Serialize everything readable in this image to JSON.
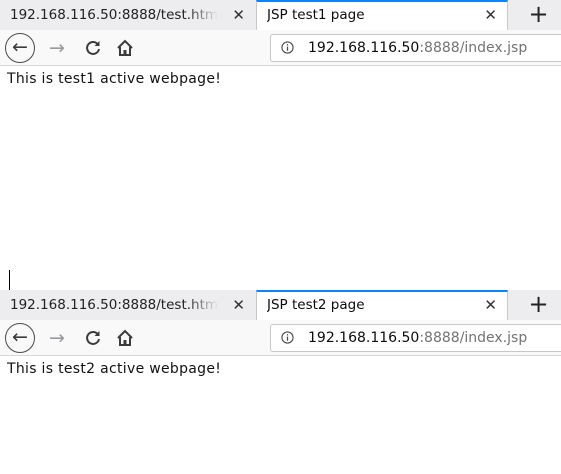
{
  "windows": [
    {
      "tabs": [
        {
          "title": "192.168.116.50:8888/test.htm",
          "active": false
        },
        {
          "title": "JSP test1 page",
          "active": true
        }
      ],
      "tab_close_glyph": "✕",
      "new_tab_glyph": "+",
      "url": {
        "host": "192.168.116.50",
        "rest": ":8888/index.jsp"
      },
      "body_text": "This is test1 active webpage!"
    },
    {
      "tabs": [
        {
          "title": "192.168.116.50:8888/test.htm",
          "active": false
        },
        {
          "title": "JSP test2 page",
          "active": true
        }
      ],
      "tab_close_glyph": "✕",
      "new_tab_glyph": "+",
      "url": {
        "host": "192.168.116.50",
        "rest": ":8888/index.jsp"
      },
      "body_text": "This is test2 active webpage!"
    }
  ],
  "icons": {
    "back": "arrow-left-icon",
    "forward": "arrow-right-icon",
    "reload": "reload-icon",
    "home": "home-icon",
    "info": "info-icon"
  },
  "colors": {
    "accent": "#0a84ff",
    "tabbar_bg": "#ededf0",
    "toolbar_bg": "#f9f9fa",
    "url_host": "#0c0c0d",
    "url_rest": "#737373"
  }
}
